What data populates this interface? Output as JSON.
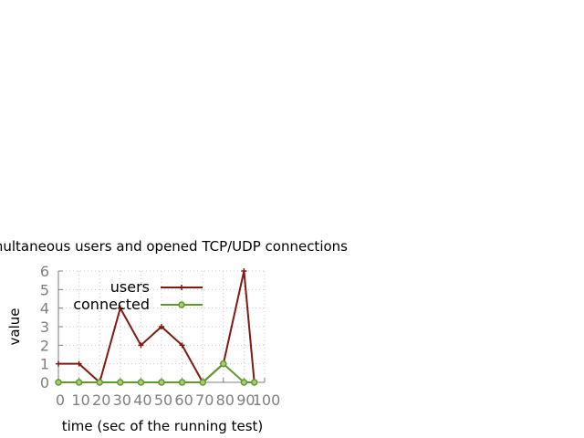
{
  "chart_data": {
    "type": "line",
    "title": "Simultaneous users and opened TCP/UDP connections",
    "xlabel": "time (sec of the running test)",
    "ylabel": "value",
    "x": [
      0,
      10,
      20,
      30,
      40,
      50,
      60,
      70,
      80,
      90,
      95
    ],
    "xlim": [
      0,
      100
    ],
    "ylim": [
      0,
      6
    ],
    "x_ticks": [
      "0",
      "10",
      "20",
      "30",
      "40",
      "50",
      "60",
      "70",
      "80",
      "90",
      "100"
    ],
    "y_ticks": [
      "0",
      "1",
      "2",
      "3",
      "4",
      "5",
      "6"
    ],
    "grid": true,
    "legend_position": "top-left",
    "series": [
      {
        "name": "users",
        "color": "#7f1a12",
        "marker": "plus",
        "values": [
          1,
          1,
          0,
          4,
          2,
          3,
          2,
          0,
          1,
          6,
          0
        ]
      },
      {
        "name": "connected",
        "color": "#5e9a2c",
        "marker": "circle",
        "values": [
          0,
          0,
          0,
          0,
          0,
          0,
          0,
          0,
          1,
          0,
          0
        ]
      }
    ]
  }
}
